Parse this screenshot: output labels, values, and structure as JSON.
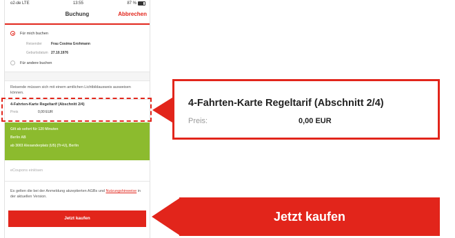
{
  "status_bar": {
    "carrier": "o2-de LTE",
    "time": "13:55",
    "battery": "87 %"
  },
  "nav": {
    "title": "Buchung",
    "cancel": "Abbrechen"
  },
  "booking": {
    "self_option": "Für mich buchen",
    "traveler_label": "Reisender",
    "traveler_value": "Frau Cosima Grohmann",
    "birth_label": "Geburtsdatum",
    "birth_value": "27.10.1976",
    "other_option": "Für andere buchen"
  },
  "notice": "Reisende müssen sich mit einem amtlichen Lichtbildausweis ausweisen können.",
  "ticket": {
    "name": "4-Fahrten-Karte Regeltarif (Abschnitt 2/4)",
    "price_label": "Preis",
    "price_value": "0,00 EUR"
  },
  "validity": {
    "line1": "Gilt ab sofort für 120 Minuten",
    "line2": "Berlin AB",
    "line3": "ab 3003 Alexanderplatz (U5) (Tr+U), Berlin"
  },
  "coupon_placeholder": "eCoupons einlösen",
  "agb": {
    "prefix": "Es gelten die bei der Anmeldung akzeptierten AGBs und ",
    "link": "Nutzungshinweise",
    "suffix": " in der aktuellen Version."
  },
  "buy_button": "Jetzt kaufen",
  "callout_ticket": {
    "name": "4-Fahrten-Karte Regeltarif (Abschnitt 2/4)",
    "price_label": "Preis:",
    "price_value": "0,00 EUR"
  },
  "callout_buy": "Jetzt kaufen",
  "colors": {
    "accent": "#e2251b",
    "green": "#8cbb2e"
  }
}
